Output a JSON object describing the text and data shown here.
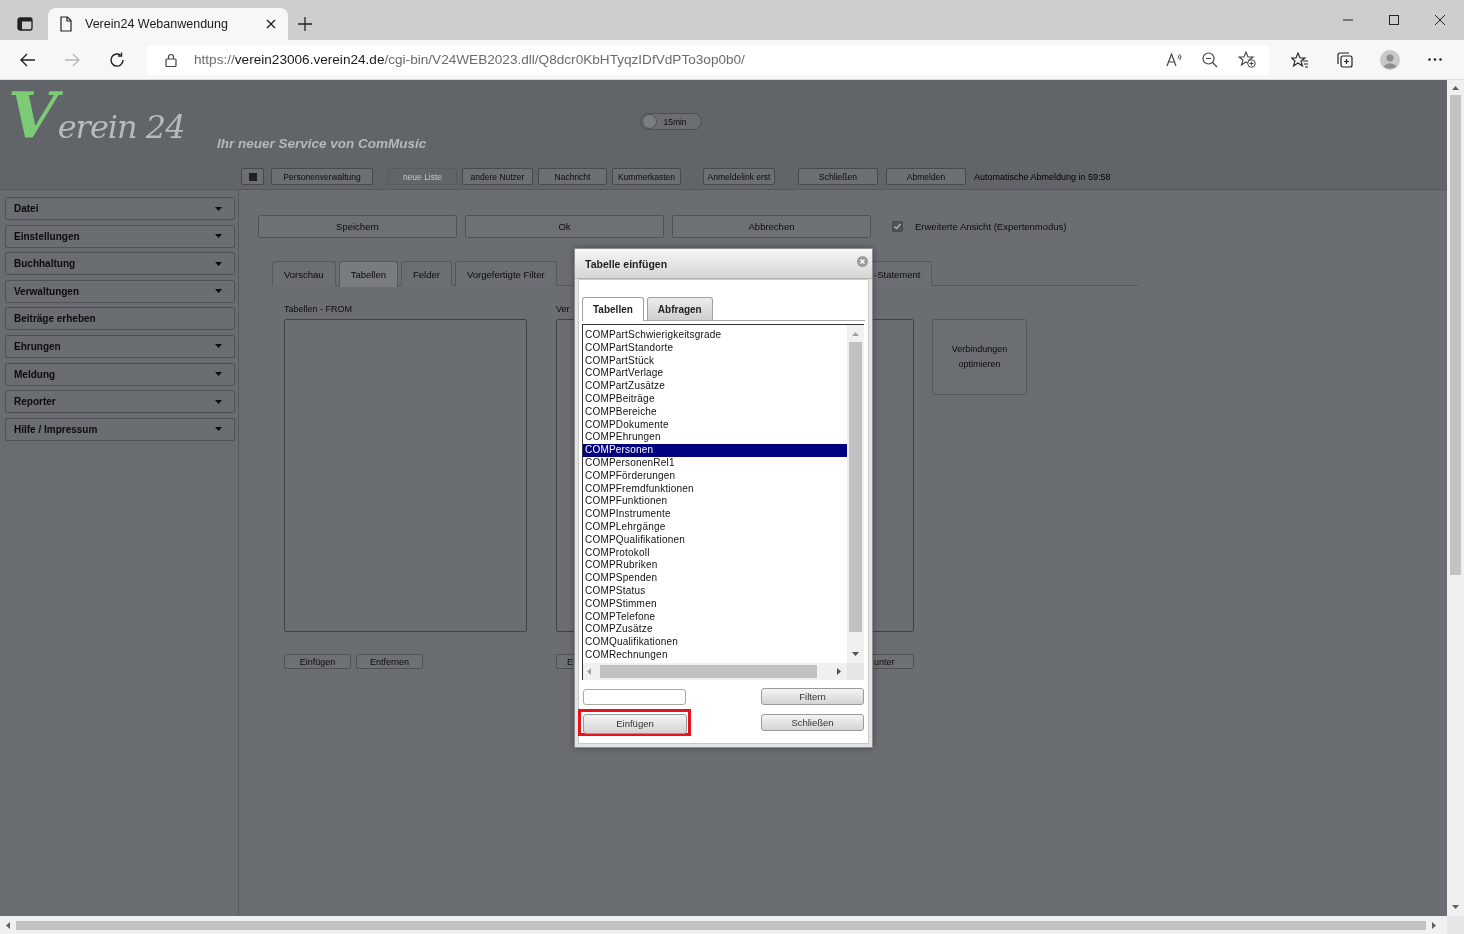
{
  "browser": {
    "tab_title": "Verein24 Webanwendung",
    "forward_disabled": true,
    "url": {
      "scheme": "https://",
      "host": "verein23006.verein24.de",
      "path": "/cgi-bin/V24WEB2023.dll/Q8dcr0KbHTyqzIDfVdPTo3op0b0/"
    }
  },
  "header": {
    "logo": {
      "initial": "V",
      "rest": "erein 24"
    },
    "slogan": "Ihr neuer Service von ComMusic",
    "timer_toggle": {
      "label": "15min",
      "on": false
    },
    "toolbar": [
      {
        "kind": "icon",
        "disabled": false
      },
      {
        "kind": "text",
        "label": "Personenverwaltung",
        "disabled": false
      },
      {
        "kind": "text",
        "label": "neue Liste",
        "disabled": true
      },
      {
        "kind": "text",
        "label": "andere Nutzer",
        "disabled": false
      },
      {
        "kind": "text",
        "label": "Nachricht",
        "disabled": false
      },
      {
        "kind": "text",
        "label": "Kummerkasten",
        "disabled": false
      },
      {
        "kind": "text",
        "label": "Anmeldelink erst",
        "disabled": false
      },
      {
        "kind": "text",
        "label": "Schließen",
        "disabled": false
      },
      {
        "kind": "text",
        "label": "Abmelden",
        "disabled": false
      }
    ],
    "auto_logout": "Automatische Abmeldung in 59:58"
  },
  "sidebar": {
    "items": [
      {
        "label": "Datei",
        "dropdown": true
      },
      {
        "label": "Einstellungen",
        "dropdown": true
      },
      {
        "label": "Buchhaltung",
        "dropdown": true
      },
      {
        "label": "Verwaltungen",
        "dropdown": true
      },
      {
        "label": "Beiträge erheben",
        "dropdown": false
      },
      {
        "label": "Ehrungen",
        "dropdown": true
      },
      {
        "label": "Meldung",
        "dropdown": true
      },
      {
        "label": "Reporter",
        "dropdown": true
      },
      {
        "label": "Hilfe / Impressum",
        "dropdown": true
      }
    ]
  },
  "main": {
    "actions": [
      "Speichern",
      "Ok",
      "Abbrechen"
    ],
    "expert_mode": {
      "label": "Erweiterte Ansicht (Expertenmodus)",
      "checked": true
    },
    "tabs": [
      {
        "label": "Vorschau",
        "selected": false,
        "cut": false
      },
      {
        "label": "Tabellen",
        "selected": true,
        "cut": false
      },
      {
        "label": "Felder",
        "selected": false,
        "cut": false
      },
      {
        "label": "Vorgefertigte Filter",
        "selected": false,
        "cut": false
      },
      {
        "label": "-Statement",
        "selected": false,
        "cut": true
      }
    ],
    "columns": [
      {
        "label": "Tabellen - FROM",
        "buttons": [
          "Einfügen",
          "Entfernen"
        ],
        "covered": false
      },
      {
        "label": "Ver",
        "buttons": [
          "E",
          "unter"
        ],
        "covered": true
      }
    ],
    "optimize_button": "Verbindungen optimieren"
  },
  "dialog": {
    "title": "Tabelle einfügen",
    "tabs": [
      {
        "label": "Tabellen",
        "selected": true
      },
      {
        "label": "Abfragen",
        "selected": false
      }
    ],
    "items": [
      {
        "label": "COMPartSchwierigkeitsgrade",
        "selected": false
      },
      {
        "label": "COMPartStandorte",
        "selected": false
      },
      {
        "label": "COMPartStück",
        "selected": false
      },
      {
        "label": "COMPartVerlage",
        "selected": false
      },
      {
        "label": "COMPartZusätze",
        "selected": false
      },
      {
        "label": "COMPBeiträge",
        "selected": false
      },
      {
        "label": "COMPBereiche",
        "selected": false
      },
      {
        "label": "COMPDokumente",
        "selected": false
      },
      {
        "label": "COMPEhrungen",
        "selected": false
      },
      {
        "label": "COMPersonen",
        "selected": true
      },
      {
        "label": "COMPersonenRel1",
        "selected": false
      },
      {
        "label": "COMPFörderungen",
        "selected": false
      },
      {
        "label": "COMPFremdfunktionen",
        "selected": false
      },
      {
        "label": "COMPFunktionen",
        "selected": false
      },
      {
        "label": "COMPInstrumente",
        "selected": false
      },
      {
        "label": "COMPLehrgänge",
        "selected": false
      },
      {
        "label": "COMPQualifikationen",
        "selected": false
      },
      {
        "label": "COMProtokoll",
        "selected": false
      },
      {
        "label": "COMPRubriken",
        "selected": false
      },
      {
        "label": "COMPSpenden",
        "selected": false
      },
      {
        "label": "COMPStatus",
        "selected": false
      },
      {
        "label": "COMPStimmen",
        "selected": false
      },
      {
        "label": "COMPTelefone",
        "selected": false
      },
      {
        "label": "COMPZusätze",
        "selected": false
      },
      {
        "label": "COMQualifikationen",
        "selected": false
      },
      {
        "label": "COMRechnungen",
        "selected": false
      }
    ],
    "filter_button": "Filtern",
    "insert_button": {
      "label": "Einfügen",
      "highlighted": true
    },
    "close_button": "Schließen"
  }
}
